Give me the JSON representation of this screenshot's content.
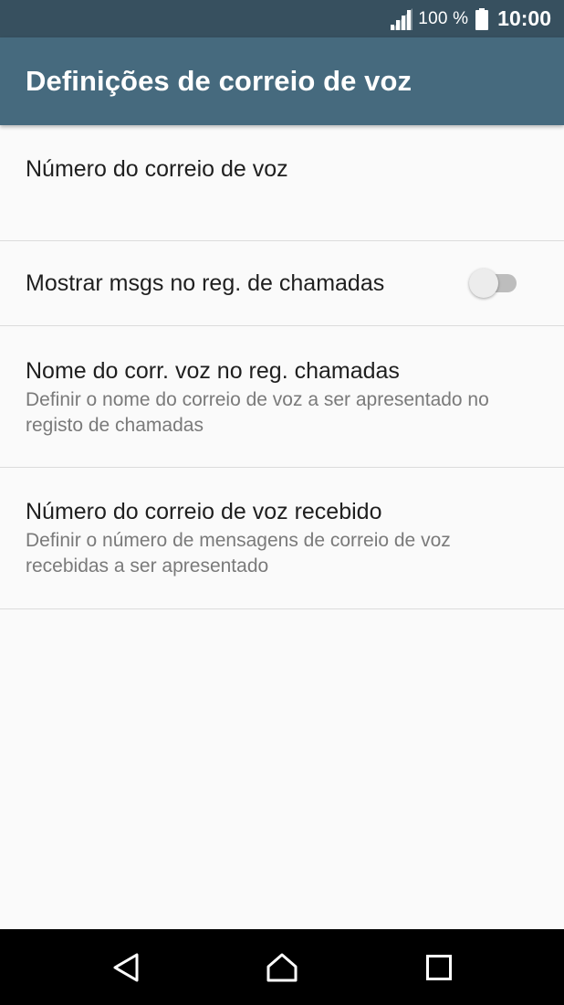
{
  "status_bar": {
    "battery_percent": "100 %",
    "time": "10:00"
  },
  "app_bar": {
    "title": "Definições de correio de voz"
  },
  "settings": [
    {
      "title": "Número do correio de voz",
      "summary": ""
    },
    {
      "title": "Mostrar msgs no reg. de chamadas",
      "toggle_on": false
    },
    {
      "title": "Nome do corr. voz no reg. chamadas",
      "summary": "Definir o nome do correio de voz a ser apresentado no registo de chamadas"
    },
    {
      "title": "Número do correio de voz recebido",
      "summary": "Definir o número de mensagens de correio de voz recebidas a ser apresentado"
    }
  ],
  "nav_bar": {
    "icons": [
      "back-icon",
      "home-icon",
      "recents-icon"
    ]
  },
  "colors": {
    "status_bar": "#37505f",
    "app_bar": "#466a7e",
    "background": "#fafafa",
    "nav_bar": "#000000"
  }
}
